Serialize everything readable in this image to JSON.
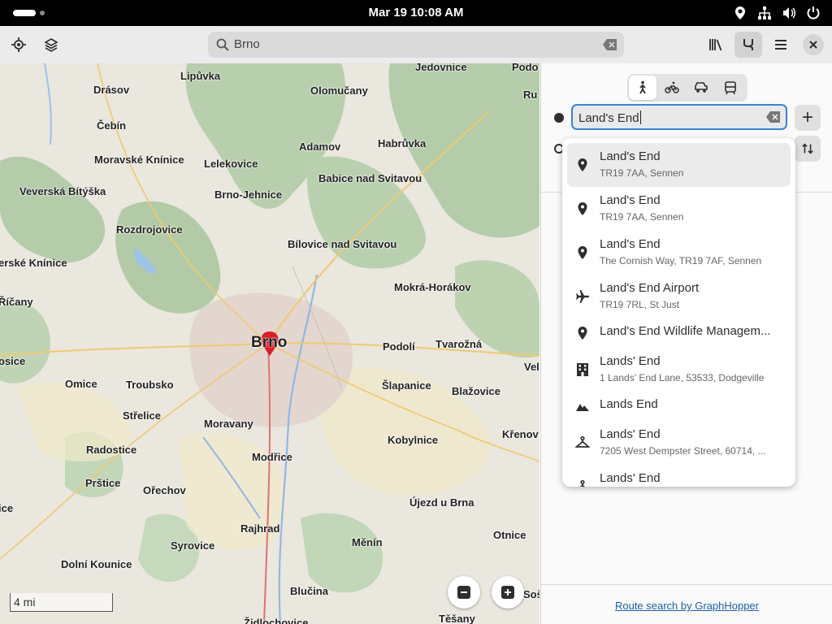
{
  "topbar": {
    "date": "Mar 19",
    "time": "10:08 AM"
  },
  "header": {
    "search_value": "Brno",
    "icons": [
      "location-icon",
      "layers-icon",
      "library-icon",
      "route-icon",
      "menu-icon",
      "close-icon"
    ]
  },
  "map": {
    "places": [
      {
        "name": "Lipůvka"
      },
      {
        "name": "Jedovnice"
      },
      {
        "name": "Podo"
      },
      {
        "name": "Drásov"
      },
      {
        "name": "Olomučany"
      },
      {
        "name": "Ru"
      },
      {
        "name": "Čebín"
      },
      {
        "name": "Adamov"
      },
      {
        "name": "Habrůvka"
      },
      {
        "name": "Moravské Knínice"
      },
      {
        "name": "Lelekovice"
      },
      {
        "name": "Babice nad Svitavou"
      },
      {
        "name": "Veverská Bítýška"
      },
      {
        "name": "Brno-Jehnice"
      },
      {
        "name": "Rozdrojovice"
      },
      {
        "name": "Bílovice nad Svitavou"
      },
      {
        "name": "erské Knínice"
      },
      {
        "name": "Mokrá-Horákov"
      },
      {
        "name": "Říčany"
      },
      {
        "name": "Brno"
      },
      {
        "name": "Podolí"
      },
      {
        "name": "Tvarožná"
      },
      {
        "name": "osice"
      },
      {
        "name": "Vel"
      },
      {
        "name": "Omice"
      },
      {
        "name": "Troubsko"
      },
      {
        "name": "Šlapanice"
      },
      {
        "name": "Blažovice"
      },
      {
        "name": "Střelice"
      },
      {
        "name": "Moravany"
      },
      {
        "name": "Kobylnice"
      },
      {
        "name": "Křenov"
      },
      {
        "name": "Radostice"
      },
      {
        "name": "Modřice"
      },
      {
        "name": "Prštice"
      },
      {
        "name": "Ořechov"
      },
      {
        "name": "Újezd u Brna"
      },
      {
        "name": "ice"
      },
      {
        "name": "Rajhrad"
      },
      {
        "name": "Otnice"
      },
      {
        "name": "Syrovice"
      },
      {
        "name": "Měnín"
      },
      {
        "name": "Dolní Kounice"
      },
      {
        "name": "Blučina"
      },
      {
        "name": "Těšany"
      },
      {
        "name": "Židlochovice"
      },
      {
        "name": "Sošo"
      }
    ],
    "scale_label": "4 mi"
  },
  "route": {
    "modes": [
      "walking-icon",
      "cycling-icon",
      "car-icon",
      "transit-icon"
    ],
    "selected_mode": "walking",
    "from_value": "Land's End"
  },
  "suggestions": [
    {
      "title": "Land's End",
      "subtitle": "TR19 7AA, Sennen",
      "icon": "pin-icon"
    },
    {
      "title": "Land's End",
      "subtitle": "TR19 7AA, Sennen",
      "icon": "pin-icon"
    },
    {
      "title": "Land's End",
      "subtitle": "The Cornish Way, TR19 7AF, Sennen",
      "icon": "pin-icon"
    },
    {
      "title": "Land's End Airport",
      "subtitle": "TR19 7RL, St Just",
      "icon": "airplane-icon"
    },
    {
      "title": "Land's End Wildlife Managem...",
      "subtitle": "",
      "icon": "pin-icon"
    },
    {
      "title": "Lands' End",
      "subtitle": "1 Lands' End Lane, 53533, Dodgeville",
      "icon": "building-icon"
    },
    {
      "title": "Lands End",
      "subtitle": "",
      "icon": "mountain-icon"
    },
    {
      "title": "Lands' End",
      "subtitle": "7205 West Dempster Street, 60714, ...",
      "icon": "clothing-icon"
    },
    {
      "title": "Lands' End",
      "subtitle": "",
      "icon": "clothing-icon"
    }
  ],
  "footer": {
    "credit": "Route search by GraphHopper"
  }
}
